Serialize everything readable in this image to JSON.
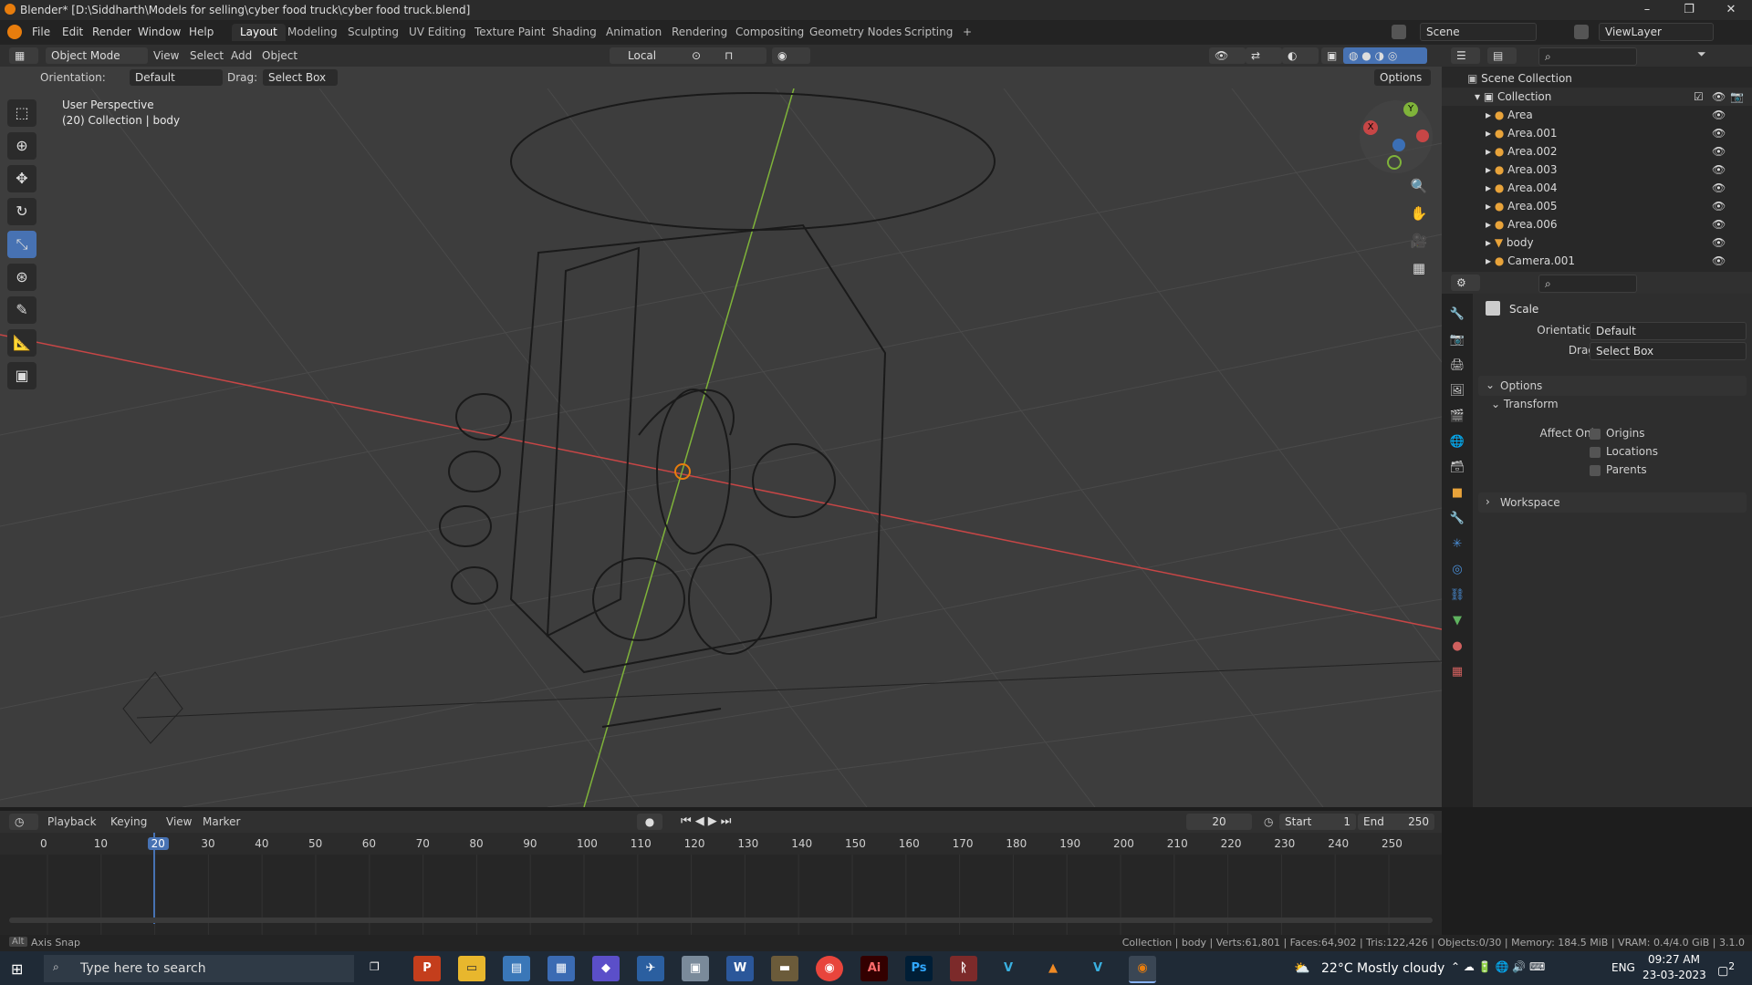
{
  "window": {
    "title": "Blender* [D:\\Siddharth\\Models for selling\\cyber food truck\\cyber food truck.blend]",
    "controls": [
      "–",
      "❐",
      "✕"
    ]
  },
  "menu": [
    "File",
    "Edit",
    "Render",
    "Window",
    "Help"
  ],
  "workspaces": {
    "tabs": [
      "Layout",
      "Modeling",
      "Sculpting",
      "UV Editing",
      "Texture Paint",
      "Shading",
      "Animation",
      "Rendering",
      "Compositing",
      "Geometry Nodes",
      "Scripting"
    ],
    "active": "Layout",
    "add": "+"
  },
  "scene": {
    "name": "Scene",
    "view_layer": "ViewLayer"
  },
  "viewport_header": {
    "mode": "Object Mode",
    "menus": [
      "View",
      "Select",
      "Add",
      "Object"
    ],
    "transform_orientation": "Local",
    "options": "Options"
  },
  "tool_settings": {
    "orientation_label": "Orientation:",
    "orientation_value": "Default",
    "drag_label": "Drag:",
    "drag_value": "Select Box"
  },
  "viewport": {
    "info_line1": "User Perspective",
    "info_line2": "(20) Collection | body",
    "gizmo": {
      "x": "X",
      "y": "Y"
    }
  },
  "outliner": {
    "scene_collection": "Scene Collection",
    "collection": "Collection",
    "items": [
      "Area",
      "Area.001",
      "Area.002",
      "Area.003",
      "Area.004",
      "Area.005",
      "Area.006",
      "body",
      "Camera.001"
    ]
  },
  "properties": {
    "tool_name": "Scale",
    "orientation_label": "Orientation",
    "orientation_value": "Default",
    "drag_label": "Drag:",
    "drag_value": "Select Box",
    "options_panel": "Options",
    "transform_panel": "Transform",
    "affect_only_label": "Affect Only",
    "affect_only": [
      "Origins",
      "Locations",
      "Parents"
    ],
    "workspace_panel": "Workspace"
  },
  "timeline": {
    "menus": [
      "Playback",
      "Keying",
      "View",
      "Marker"
    ],
    "current_frame": "20",
    "start_label": "Start",
    "start": "1",
    "end_label": "End",
    "end": "250",
    "ruler": [
      "0",
      "10",
      "20",
      "30",
      "40",
      "50",
      "60",
      "70",
      "80",
      "90",
      "100",
      "110",
      "120",
      "130",
      "140",
      "150",
      "160",
      "170",
      "180",
      "190",
      "200",
      "210",
      "220",
      "230",
      "240",
      "250"
    ]
  },
  "statusbar": {
    "left": "Axis Snap",
    "right": "Collection | body | Verts:61,801 | Faces:64,902 | Tris:122,426 | Objects:0/30 | Memory: 184.5 MiB | VRAM: 0.4/4.0 GiB | 3.1.0"
  },
  "taskbar": {
    "search_placeholder": "Type here to search",
    "weather": "22°C  Mostly cloudy",
    "lang": "ENG",
    "time": "09:27 AM",
    "date": "23-03-2023",
    "notif": "2"
  },
  "colors": {
    "accent": "#4772b3",
    "x_axis": "#c74646",
    "y_axis": "#7fb33a",
    "blender_orange": "#e87d0d"
  }
}
